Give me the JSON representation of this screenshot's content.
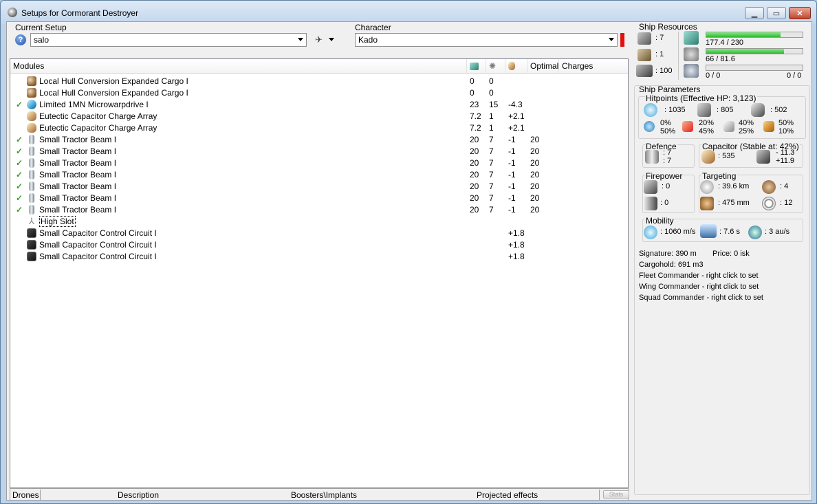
{
  "window": {
    "title": "Setups for Cormorant Destroyer"
  },
  "setup": {
    "label": "Current Setup",
    "value": "salo"
  },
  "character": {
    "label": "Character",
    "value": "Kado"
  },
  "modules": {
    "headers": {
      "name": "Modules",
      "optimal": "Optimal",
      "charges": "Charges"
    },
    "rows": [
      {
        "check": "",
        "icon": "cargo-expander-icon",
        "name": "Local Hull Conversion Expanded Cargo I",
        "cpu": "0",
        "pg": "0",
        "cap": "",
        "optimal": ""
      },
      {
        "check": "",
        "icon": "cargo-expander-icon",
        "name": "Local Hull Conversion Expanded Cargo I",
        "cpu": "0",
        "pg": "0",
        "cap": "",
        "optimal": ""
      },
      {
        "check": "✓",
        "icon": "microwarpdrive-icon",
        "name": "Limited 1MN Microwarpdrive I",
        "cpu": "23",
        "pg": "15",
        "cap": "-4.3",
        "optimal": ""
      },
      {
        "check": "",
        "icon": "capacitor-array-icon",
        "name": "Eutectic Capacitor Charge Array",
        "cpu": "7.2",
        "pg": "1",
        "cap": "+2.1",
        "optimal": ""
      },
      {
        "check": "",
        "icon": "capacitor-array-icon",
        "name": "Eutectic Capacitor Charge Array",
        "cpu": "7.2",
        "pg": "1",
        "cap": "+2.1",
        "optimal": ""
      },
      {
        "check": "✓",
        "icon": "tractor-beam-icon",
        "name": "Small Tractor Beam I",
        "cpu": "20",
        "pg": "7",
        "cap": "-1",
        "optimal": "20"
      },
      {
        "check": "✓",
        "icon": "tractor-beam-icon",
        "name": "Small Tractor Beam I",
        "cpu": "20",
        "pg": "7",
        "cap": "-1",
        "optimal": "20"
      },
      {
        "check": "✓",
        "icon": "tractor-beam-icon",
        "name": "Small Tractor Beam I",
        "cpu": "20",
        "pg": "7",
        "cap": "-1",
        "optimal": "20"
      },
      {
        "check": "✓",
        "icon": "tractor-beam-icon",
        "name": "Small Tractor Beam I",
        "cpu": "20",
        "pg": "7",
        "cap": "-1",
        "optimal": "20"
      },
      {
        "check": "✓",
        "icon": "tractor-beam-icon",
        "name": "Small Tractor Beam I",
        "cpu": "20",
        "pg": "7",
        "cap": "-1",
        "optimal": "20"
      },
      {
        "check": "✓",
        "icon": "tractor-beam-icon",
        "name": "Small Tractor Beam I",
        "cpu": "20",
        "pg": "7",
        "cap": "-1",
        "optimal": "20"
      },
      {
        "check": "✓",
        "icon": "tractor-beam-icon",
        "name": "Small Tractor Beam I",
        "cpu": "20",
        "pg": "7",
        "cap": "-1",
        "optimal": "20"
      },
      {
        "check": "",
        "icon": "high-slot-icon",
        "name": "High Slot",
        "cpu": "",
        "pg": "",
        "cap": "",
        "optimal": ""
      },
      {
        "check": "",
        "icon": "capacitor-control-circuit-icon",
        "name": "Small Capacitor Control Circuit I",
        "cpu": "",
        "pg": "",
        "cap": "+1.8",
        "optimal": ""
      },
      {
        "check": "",
        "icon": "capacitor-control-circuit-icon",
        "name": "Small Capacitor Control Circuit I",
        "cpu": "",
        "pg": "",
        "cap": "+1.8",
        "optimal": ""
      },
      {
        "check": "",
        "icon": "capacitor-control-circuit-icon",
        "name": "Small Capacitor Control Circuit I",
        "cpu": "",
        "pg": "",
        "cap": "+1.8",
        "optimal": ""
      }
    ]
  },
  "tabs": {
    "drones": "Drones",
    "description": "Description",
    "boosters": "Boosters\\Implants",
    "projected": "Projected effects",
    "stats": "Stats"
  },
  "resources": {
    "title": "Ship Resources",
    "turrets": ": 7",
    "launchers": ": 1",
    "calibration": ": 100",
    "cpu_text": "177.4 / 230",
    "cpu_fraction": 0.77,
    "pg_text": "66 / 81.6",
    "pg_fraction": 0.81,
    "drone_left": "0 / 0",
    "drone_right": "0 / 0"
  },
  "params": {
    "title": "Ship Parameters",
    "hitpoints_title": "Hitpoints (Effective HP: 3,123)",
    "shield": ": 1035",
    "armor": ": 805",
    "structure": ": 502",
    "em_a": "0%",
    "em_b": "50%",
    "th_a": "20%",
    "th_b": "45%",
    "ki_a": "40%",
    "ki_b": "25%",
    "ex_a": "50%",
    "ex_b": "10%",
    "defence_title": "Defence",
    "def_a": ": 7",
    "def_b": ": 7",
    "capacitor_title": "Capacitor (Stable at: 42%)",
    "cap_amount": ": 535",
    "cap_a": "- 11.3",
    "cap_b": "+11.9",
    "firepower_title": "Firepower",
    "fp_a": ": 0",
    "fp_b": ": 0",
    "targeting_title": "Targeting",
    "range": ": 39.6 km",
    "targets": ": 4",
    "scan_res": ": 475 mm",
    "sensor": ": 12",
    "mobility_title": "Mobility",
    "speed": ": 1060 m/s",
    "align": ": 7.6 s",
    "warp": ": 3 au/s",
    "signature": "Signature: 390 m",
    "price": "Price: 0 isk",
    "cargohold": "Cargohold: 691 m3",
    "fleet": "Fleet Commander - right click to set",
    "wing": "Wing Commander - right click to set",
    "squad": "Squad Commander - right click to set"
  }
}
